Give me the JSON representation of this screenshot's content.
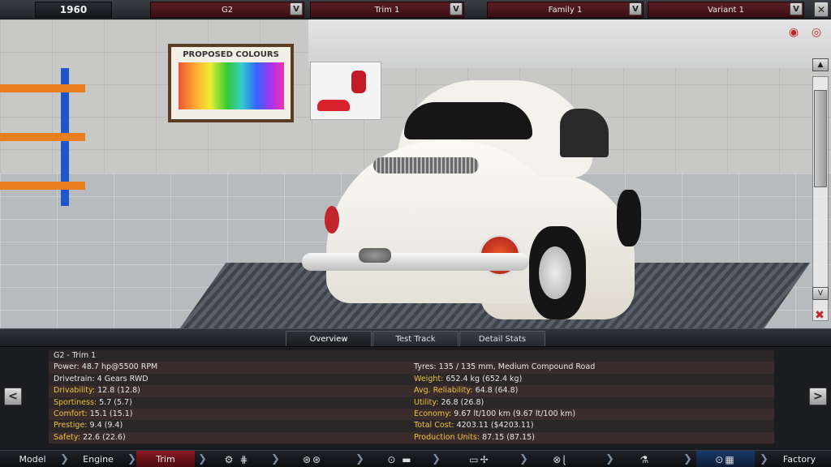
{
  "topbar": {
    "year": "1960",
    "model": "G2",
    "trim": "Trim 1",
    "family": "Family 1",
    "variant": "Variant 1",
    "dropdown_glyph": "V",
    "close_glyph": "✕"
  },
  "scene": {
    "poster_title": "PROPOSED COLOURS"
  },
  "tabs": [
    {
      "label": "Overview",
      "active": true
    },
    {
      "label": "Test Track",
      "active": false
    },
    {
      "label": "Detail Stats",
      "active": false
    }
  ],
  "stats": {
    "title": "G2 - Trim 1",
    "left": [
      {
        "label": "Power:",
        "value": "48.7 hp@5500 RPM",
        "highlight": false
      },
      {
        "label": "Drivetrain:",
        "value": "4 Gears RWD",
        "highlight": false
      },
      {
        "label": "Drivability:",
        "value": "12.8 (12.8)",
        "highlight": true
      },
      {
        "label": "Sportiness:",
        "value": "5.7 (5.7)",
        "highlight": true
      },
      {
        "label": "Comfort:",
        "value": "15.1 (15.1)",
        "highlight": true
      },
      {
        "label": "Prestige:",
        "value": "9.4 (9.4)",
        "highlight": true
      },
      {
        "label": "Safety:",
        "value": "22.6 (22.6)",
        "highlight": true
      }
    ],
    "right": [
      {
        "label": "Tyres:",
        "value": "135 / 135 mm, Medium Compound Road",
        "highlight": false
      },
      {
        "label": "Weight:",
        "value": "652.4 kg (652.4 kg)",
        "highlight": true
      },
      {
        "label": "Avg. Reliability:",
        "value": "64.8 (64.8)",
        "highlight": true
      },
      {
        "label": "Utility:",
        "value": "26.8 (26.8)",
        "highlight": true
      },
      {
        "label": "Economy:",
        "value": "9.67 lt/100 km (9.67 lt/100 km)",
        "highlight": true
      },
      {
        "label": "Total Cost:",
        "value": "4203.11 ($4203.11)",
        "highlight": true
      },
      {
        "label": "Production Units:",
        "value": "87.15 (87.15)",
        "highlight": true
      }
    ]
  },
  "nav": {
    "prev": "<",
    "next": ">"
  },
  "bottomnav": {
    "model": "Model",
    "engine": "Engine",
    "trim": "Trim",
    "factory": "Factory",
    "icons": [
      "chassis-icon",
      "suspension-icon",
      "body-icon",
      "car-icon",
      "fan-icon",
      "steering-icon",
      "seat-icon",
      "test-icon",
      "checkered-flag-icon"
    ]
  },
  "colors": {
    "accent_red": "#8a1a22",
    "stat_highlight": "#f2c23a"
  }
}
